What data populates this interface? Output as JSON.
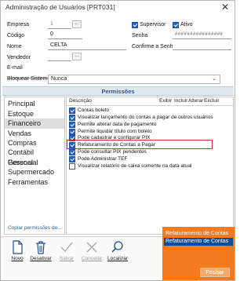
{
  "window": {
    "title": "Administração de Usuários [PRT031]",
    "close_glyph": "✕"
  },
  "form": {
    "empresa_label": "Empresa",
    "empresa_value": "1",
    "empresa_btn": "...",
    "supervisor_label": "Supervisor",
    "supervisor_checked": true,
    "ativo_label": "Ativo",
    "ativo_checked": true,
    "codigo_label": "Código",
    "codigo_value": "0",
    "senha_label": "Senha",
    "senha_value": "################",
    "nome_label": "Nome",
    "nome_value": "CELTA",
    "confirma_label": "Confirme a Senha",
    "vendedor_label": "Vendedor",
    "vendedor_btn": "...",
    "email_label": "E-mail",
    "bloquear_label": "Bloquear Sistema",
    "bloquear_value": "Nunca"
  },
  "permissoes": {
    "title": "Permissões",
    "categories": [
      {
        "label": "Principal",
        "selected": false
      },
      {
        "label": "Estoque",
        "selected": false
      },
      {
        "label": "Financeiro",
        "selected": true
      },
      {
        "label": "Vendas",
        "selected": false
      },
      {
        "label": "Compras",
        "selected": false
      },
      {
        "label": "Contábil Gerencial",
        "selected": false
      },
      {
        "label": "Pessoal",
        "selected": false
      },
      {
        "label": "Supermercado",
        "selected": false
      },
      {
        "label": "Ferramentas",
        "selected": false
      }
    ],
    "copy_link": "Copiar permissões de...",
    "columns": {
      "descricao": "Descrição",
      "exibir": "Exibir",
      "incluir": "Incluir",
      "alterar": "Alterar",
      "excluir": "Excluir"
    },
    "rows": [
      {
        "label": "Contas boleto",
        "checked": true
      },
      {
        "label": "Visualizar lançamento do contas a pagar de outros usuários",
        "checked": true
      },
      {
        "label": "Permite alterar data de pagamento",
        "checked": true
      },
      {
        "label": "Permite liquidar título com boleto",
        "checked": true
      },
      {
        "label": "Pode cadastrar e configurar PIX",
        "checked": true
      },
      {
        "label": "Refaturamento de Contas a Pagar",
        "checked": true
      },
      {
        "label": "Pode consultar PIX pendentes",
        "checked": true
      },
      {
        "label": "Pode Administrar TEF",
        "checked": true
      },
      {
        "label": "Visualizar relatório de caixa somente na data atual",
        "checked": false
      }
    ]
  },
  "toolbar": {
    "novo": "Novo",
    "desativar": "Desativar",
    "salvar": "Salvar",
    "cancelar": "Cancelar",
    "localizar": "Localizar"
  },
  "popup": {
    "item1": "Refaturamento de Contas",
    "item2": "Refaturamento de Contas",
    "fechar": "Fechar"
  },
  "colors": {
    "accent": "#2563c9",
    "popup": "#f47a1f",
    "popup_sel": "#0a4d9e",
    "highlight": "#e8222a"
  }
}
